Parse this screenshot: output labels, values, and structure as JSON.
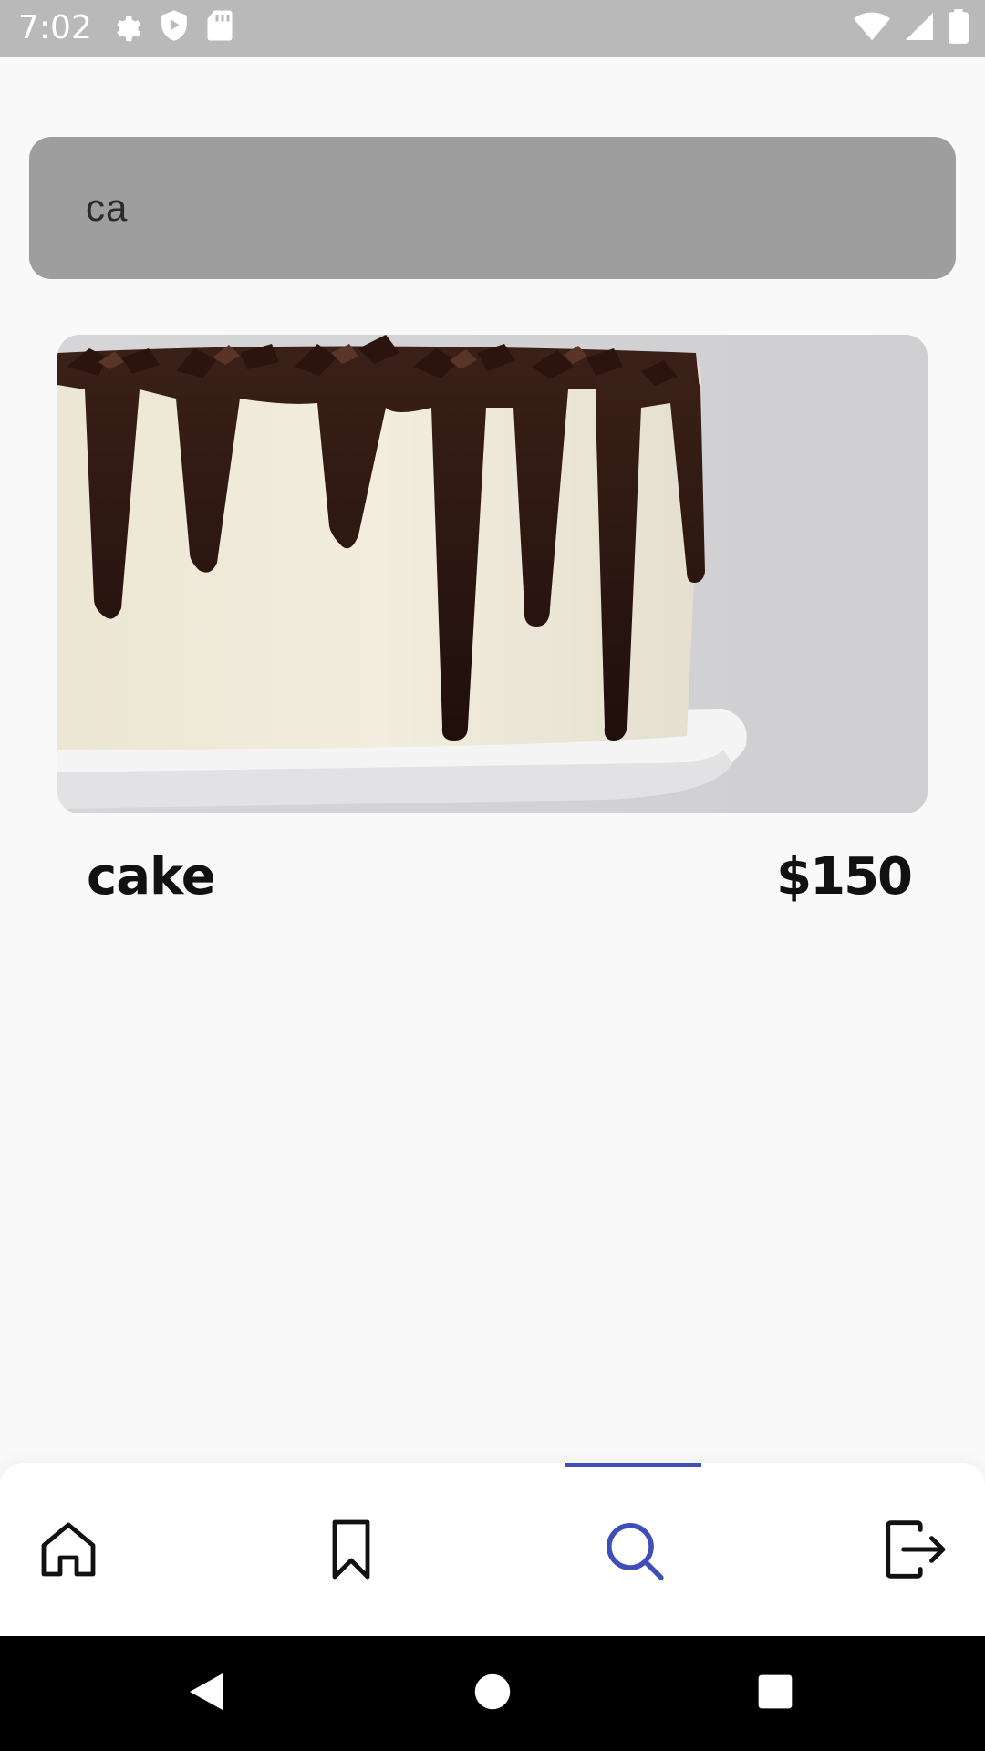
{
  "status_bar": {
    "time": "7:02",
    "left_icons": [
      "gear-icon",
      "shield-icon",
      "sd-card-icon"
    ],
    "right_icons": [
      "wifi-icon",
      "cell-signal-icon",
      "battery-icon"
    ]
  },
  "search": {
    "value": "ca",
    "placeholder": ""
  },
  "results": [
    {
      "name": "cake",
      "price": "$150",
      "image": "chocolate-drip-cake-image"
    }
  ],
  "bottom_nav": {
    "items": [
      {
        "icon": "home-icon",
        "active": false
      },
      {
        "icon": "bookmark-icon",
        "active": false
      },
      {
        "icon": "search-icon",
        "active": true
      },
      {
        "icon": "logout-icon",
        "active": false
      }
    ],
    "active_color": "#3f4fb8"
  },
  "system_nav": {
    "buttons": [
      "back-icon",
      "home-circle-icon",
      "recents-icon"
    ]
  }
}
